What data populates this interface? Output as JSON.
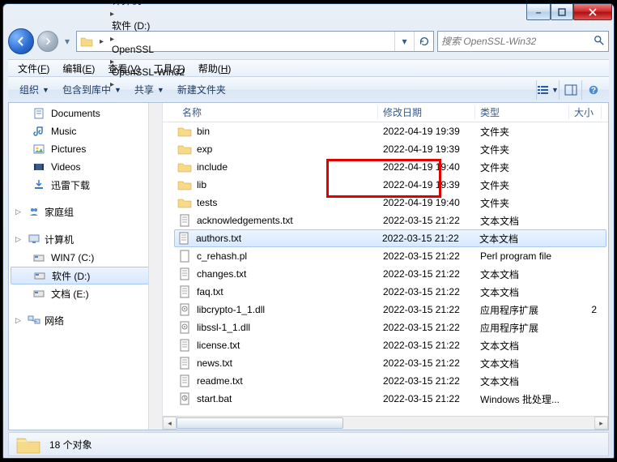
{
  "titlebar": {
    "minimize": "–",
    "maximize": "□",
    "close": "×"
  },
  "nav": {
    "crumbs": [
      "计算机",
      "软件 (D:)",
      "OpenSSL",
      "OpenSSL-Win32"
    ],
    "refresh_title": "刷新"
  },
  "search": {
    "placeholder": "搜索 OpenSSL-Win32"
  },
  "menubar": [
    {
      "label": "文件",
      "key": "F"
    },
    {
      "label": "编辑",
      "key": "E"
    },
    {
      "label": "查看",
      "key": "V"
    },
    {
      "label": "工具",
      "key": "T"
    },
    {
      "label": "帮助",
      "key": "H"
    }
  ],
  "toolbar": {
    "organize": "组织",
    "include": "包含到库中",
    "share": "共享",
    "newfolder": "新建文件夹"
  },
  "sidebar": {
    "top_items": [
      "Documents",
      "Music",
      "Pictures",
      "Videos",
      "迅雷下载"
    ],
    "groups": [
      {
        "label": "家庭组",
        "items": []
      },
      {
        "label": "计算机",
        "items": [
          "WIN7 (C:)",
          "软件 (D:)",
          "文档 (E:)"
        ],
        "selected_index": 1
      },
      {
        "label": "网络",
        "items": []
      }
    ]
  },
  "columns": {
    "name": "名称",
    "modified": "修改日期",
    "type": "类型",
    "size": "大小"
  },
  "files": [
    {
      "name": "bin",
      "modified": "2022-04-19 19:39",
      "type": "文件夹",
      "icon": "folder"
    },
    {
      "name": "exp",
      "modified": "2022-04-19 19:39",
      "type": "文件夹",
      "icon": "folder"
    },
    {
      "name": "include",
      "modified": "2022-04-19 19:40",
      "type": "文件夹",
      "icon": "folder"
    },
    {
      "name": "lib",
      "modified": "2022-04-19 19:39",
      "type": "文件夹",
      "icon": "folder"
    },
    {
      "name": "tests",
      "modified": "2022-04-19 19:40",
      "type": "文件夹",
      "icon": "folder"
    },
    {
      "name": "acknowledgements.txt",
      "modified": "2022-03-15 21:22",
      "type": "文本文档",
      "icon": "txt"
    },
    {
      "name": "authors.txt",
      "modified": "2022-03-15 21:22",
      "type": "文本文档",
      "icon": "txt",
      "selected": true
    },
    {
      "name": "c_rehash.pl",
      "modified": "2022-03-15 21:22",
      "type": "Perl program file",
      "icon": "file"
    },
    {
      "name": "changes.txt",
      "modified": "2022-03-15 21:22",
      "type": "文本文档",
      "icon": "txt"
    },
    {
      "name": "faq.txt",
      "modified": "2022-03-15 21:22",
      "type": "文本文档",
      "icon": "txt"
    },
    {
      "name": "libcrypto-1_1.dll",
      "modified": "2022-03-15 21:22",
      "type": "应用程序扩展",
      "icon": "dll",
      "size": "2"
    },
    {
      "name": "libssl-1_1.dll",
      "modified": "2022-03-15 21:22",
      "type": "应用程序扩展",
      "icon": "dll"
    },
    {
      "name": "license.txt",
      "modified": "2022-03-15 21:22",
      "type": "文本文档",
      "icon": "txt"
    },
    {
      "name": "news.txt",
      "modified": "2022-03-15 21:22",
      "type": "文本文档",
      "icon": "txt"
    },
    {
      "name": "readme.txt",
      "modified": "2022-03-15 21:22",
      "type": "文本文档",
      "icon": "txt"
    },
    {
      "name": "start.bat",
      "modified": "2022-03-15 21:22",
      "type": "Windows 批处理...",
      "icon": "bat"
    }
  ],
  "status": {
    "count_label": "18 个对象"
  }
}
